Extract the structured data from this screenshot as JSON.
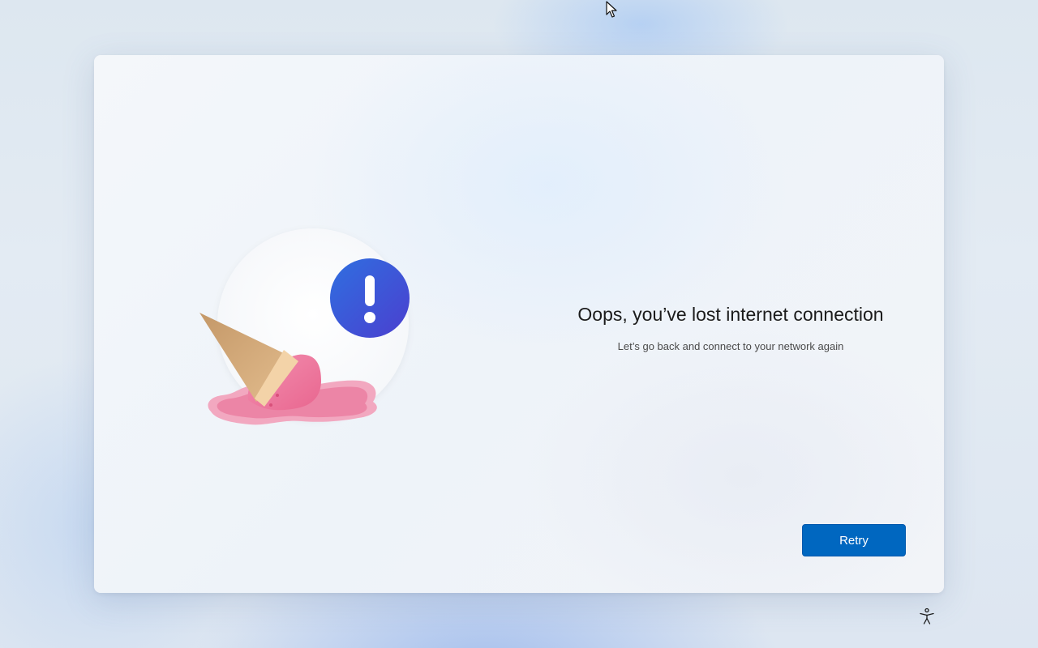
{
  "dialog": {
    "title": "Oops, you’ve lost internet connection",
    "subtitle": "Let’s go back and connect to your network again",
    "retry_label": "Retry",
    "illustration": {
      "main": "melted-ice-cream-illustration",
      "badge": "exclamation-icon",
      "badge_color": "#3d5ad9"
    }
  },
  "taskbar": {
    "accessibility_icon": "accessibility-icon"
  },
  "colors": {
    "accent": "#0067c0",
    "title_text": "#1b1b1b",
    "subtitle_text": "#4a4a4a"
  }
}
